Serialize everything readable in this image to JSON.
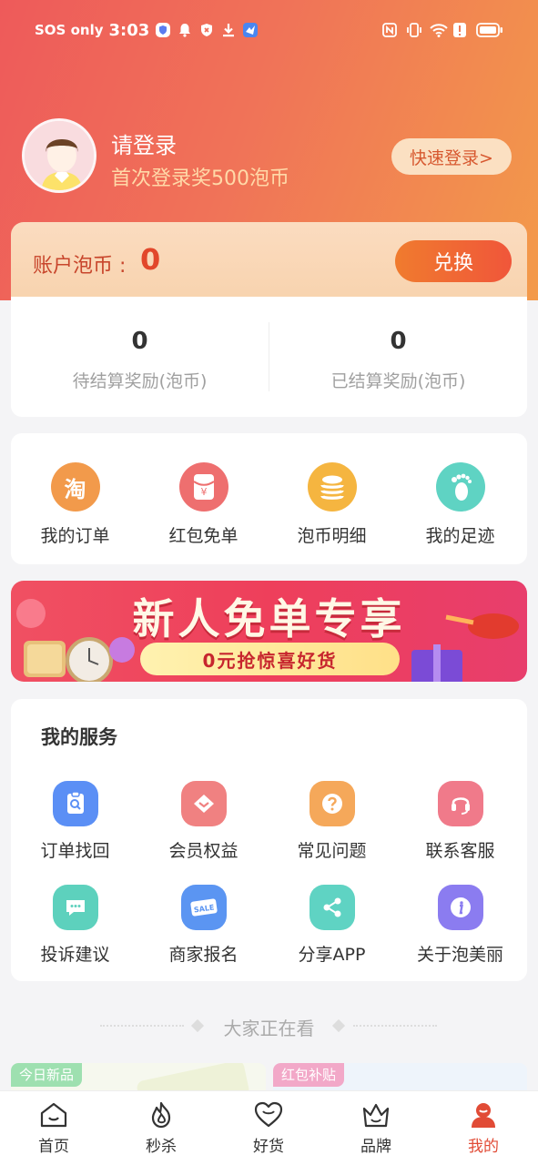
{
  "status_bar": {
    "carrier": "SOS only",
    "time": "3:03"
  },
  "profile": {
    "login_title": "请登录",
    "login_subtitle": "首次登录奖500泡币",
    "quick_login": "快速登录>"
  },
  "account": {
    "label": "账户泡币 :",
    "value": "0",
    "exchange": "兑换"
  },
  "rewards": [
    {
      "value": "0",
      "label": "待结算奖励(泡币)"
    },
    {
      "value": "0",
      "label": "已结算奖励(泡币)"
    }
  ],
  "shortcuts": [
    {
      "label": "我的订单",
      "icon": "taobao-icon",
      "color": "#f29a4b",
      "glyph": "淘"
    },
    {
      "label": "红包免单",
      "icon": "red-envelope-icon",
      "color": "#ee6f6f",
      "glyph": "¥"
    },
    {
      "label": "泡币明细",
      "icon": "coin-stack-icon",
      "color": "#f5b540",
      "glyph": ""
    },
    {
      "label": "我的足迹",
      "icon": "footprint-icon",
      "color": "#5fd3c3",
      "glyph": ""
    }
  ],
  "banner": {
    "title": "新人免单专享",
    "subtitle": "0元抢惊喜好货"
  },
  "services": {
    "title": "我的服务",
    "items": [
      {
        "label": "订单找回",
        "icon": "order-search-icon",
        "color": "#5b8ff5"
      },
      {
        "label": "会员权益",
        "icon": "diamond-icon",
        "color": "#f08181"
      },
      {
        "label": "常见问题",
        "icon": "question-icon",
        "color": "#f5a85a"
      },
      {
        "label": "联系客服",
        "icon": "headset-icon",
        "color": "#f07a8a"
      },
      {
        "label": "投诉建议",
        "icon": "chat-icon",
        "color": "#5dd1bd"
      },
      {
        "label": "商家报名",
        "icon": "sale-tag-icon",
        "color": "#5b95f2"
      },
      {
        "label": "分享APP",
        "icon": "share-icon",
        "color": "#5fd3c3"
      },
      {
        "label": "关于泡美丽",
        "icon": "info-icon",
        "color": "#8b7cf0"
      }
    ]
  },
  "feed": {
    "section_title": "大家正在看",
    "tags": [
      "今日新品",
      "红包补贴"
    ]
  },
  "tabbar": {
    "items": [
      {
        "label": "首页",
        "icon": "home-icon"
      },
      {
        "label": "秒杀",
        "icon": "flame-icon"
      },
      {
        "label": "好货",
        "icon": "heart-icon"
      },
      {
        "label": "品牌",
        "icon": "crown-icon"
      },
      {
        "label": "我的",
        "icon": "profile-icon"
      }
    ],
    "active": "我的",
    "active_color": "#e14b36"
  }
}
